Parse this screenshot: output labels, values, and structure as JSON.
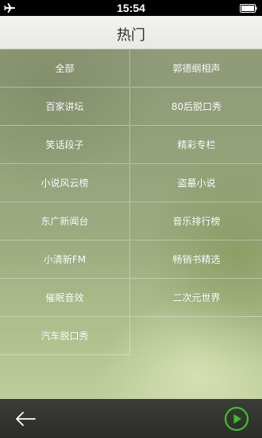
{
  "status": {
    "time": "15:54",
    "icons": [
      "airplane-icon",
      "battery-icon"
    ]
  },
  "header": {
    "title": "热门"
  },
  "categories": [
    "全部",
    "郭德纲相声",
    "百家讲坛",
    "80后脱口秀",
    "笑话段子",
    "精彩专栏",
    "小说风云榜",
    "盗墓小说",
    "东广新闻台",
    "音乐排行榜",
    "小清新FM",
    "畅销书精选",
    "催眠音效",
    "二次元世界",
    "汽车脱口秀"
  ],
  "bottom": {
    "icons": [
      "back-arrow-icon",
      "play-icon"
    ]
  },
  "colors": {
    "accent_green": "#3fbf2a",
    "header_bg": "#eeeeea",
    "bottom_bar_bg": "#33342f"
  }
}
